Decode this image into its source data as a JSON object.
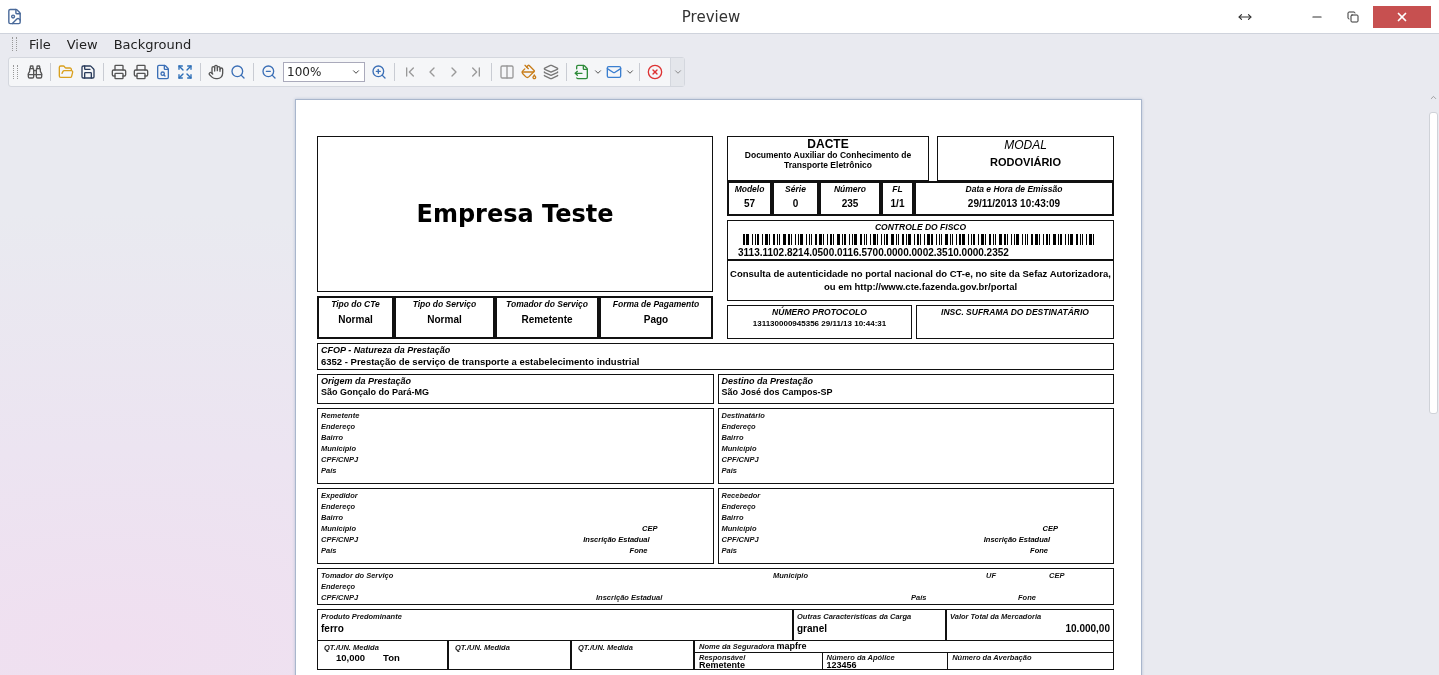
{
  "window": {
    "title": "Preview"
  },
  "menu": [
    "File",
    "View",
    "Background"
  ],
  "toolbar": {
    "zoom": "100%"
  },
  "document": {
    "company": "Empresa Teste",
    "dacte": {
      "title": "DACTE",
      "subtitle": "Documento Auxiliar do Conhecimento de Transporte Eletrônico"
    },
    "modal": {
      "label": "MODAL",
      "value": "RODOVIÁRIO"
    },
    "id_fields": [
      {
        "label": "Modelo",
        "value": "57"
      },
      {
        "label": "Série",
        "value": "0"
      },
      {
        "label": "Número",
        "value": "235"
      },
      {
        "label": "FL",
        "value": "1/1"
      },
      {
        "label": "Data e Hora de Emissão",
        "value": "29/11/2013 10:43:09"
      }
    ],
    "fisco": {
      "label": "CONTROLE DO FISCO",
      "key": "3113.1102.8214.0500.0116.5700.0000.0002.3510.0000.2352"
    },
    "consulta": "Consulta de autenticidade no portal nacional do CT-e, no site da Sefaz Autorizadora, ou em http://www.cte.fazenda.gov.br/portal",
    "protocolo": {
      "label": "NÚMERO PROTOCOLO",
      "value": "131130000945356 29/11/13 10:44:31"
    },
    "suframa": {
      "label": "INSC. SUFRAMA DO DESTINATÁRIO"
    },
    "service_fields": [
      {
        "label": "Tipo do CTe",
        "value": "Normal"
      },
      {
        "label": "Tipo do Serviço",
        "value": "Normal"
      },
      {
        "label": "Tomador do Serviço",
        "value": "Remetente"
      },
      {
        "label": "Forma de Pagamento",
        "value": "Pago"
      }
    ],
    "cfop": {
      "label": "CFOP - Natureza da Prestação",
      "value": "6352 - Prestação de serviço de transporte a estabelecimento industrial"
    },
    "route": [
      {
        "label": "Origem da Prestação",
        "value": "São Gonçalo do Pará-MG"
      },
      {
        "label": "Destino da Prestação",
        "value": "São José dos Campos-SP"
      }
    ],
    "parties": [
      {
        "title": "Remetente",
        "fields": [
          {
            "label": "Endereço"
          },
          {
            "label": "Bairro"
          },
          {
            "label": "Município"
          },
          {
            "label": "CPF/CNPJ"
          },
          {
            "label": "País"
          }
        ]
      },
      {
        "title": "Destinatário",
        "fields": [
          {
            "label": "Endereço"
          },
          {
            "label": "Bairro"
          },
          {
            "label": "Município"
          },
          {
            "label": "CPF/CNPJ"
          },
          {
            "label": "País"
          }
        ]
      },
      {
        "title": "Expedidor",
        "fields": [
          {
            "label": "Endereço"
          },
          {
            "label": "Bairro"
          },
          {
            "label": "Município",
            "extra": "CEP"
          },
          {
            "label": "CPF/CNPJ",
            "extra": "Inscrição Estadual"
          },
          {
            "label": "País",
            "extra": "Fone"
          }
        ]
      },
      {
        "title": "Recebedor",
        "fields": [
          {
            "label": "Endereço"
          },
          {
            "label": "Bairro"
          },
          {
            "label": "Município",
            "extra": "CEP"
          },
          {
            "label": "CPF/CNPJ",
            "extra": "Inscrição Estadual"
          },
          {
            "label": "País",
            "extra": "Fone"
          }
        ]
      }
    ],
    "tomador": [
      [
        "Tomador do Serviço",
        "Município",
        "UF",
        "CEP"
      ],
      [
        "Endereço"
      ],
      [
        "CPF/CNPJ",
        "Inscrição Estadual",
        "País",
        "Fone"
      ]
    ],
    "cargo": [
      {
        "label": "Produto Predominante",
        "value": "ferro"
      },
      {
        "label": "Outras Características da Carga",
        "value": "granel"
      },
      {
        "label": "Valor Total da Mercadoria",
        "value": "10.000,00"
      }
    ],
    "quantities": [
      {
        "label": "QT./UN. Medida",
        "value": "10,000",
        "unit": "Ton"
      },
      {
        "label": "QT./UN. Medida"
      },
      {
        "label": "QT./UN. Medida"
      }
    ],
    "seguro": {
      "label": "Nome da Seguradora",
      "value": "mapfre",
      "columns": [
        {
          "label": "Responsável",
          "value": "Remetente"
        },
        {
          "label": "Número da Apólice",
          "value": "123456"
        },
        {
          "label": "Número da Averbação"
        }
      ]
    }
  }
}
